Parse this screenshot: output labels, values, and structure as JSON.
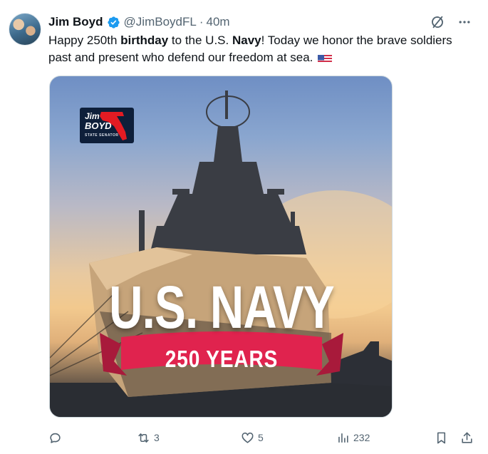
{
  "user": {
    "name": "Jim Boyd",
    "handle": "@JimBoydFL",
    "separator": "·",
    "time": "40m"
  },
  "tweet": {
    "text_part1": "Happy 250th ",
    "text_bold1": "birthday",
    "text_part2": " to the U.S. ",
    "text_bold2": "Navy",
    "text_part3": "! Today we honor the brave soldiers past and present who defend our freedom at sea. "
  },
  "media": {
    "logo_line1": "Jim",
    "logo_line2": "BOYD",
    "logo_line3": "STATE SENATOR",
    "headline": "U.S. NAVY",
    "banner": "250 YEARS"
  },
  "actions": {
    "reply_icon": "reply-icon",
    "repost_count": "3",
    "like_count": "5",
    "views_count": "232",
    "bookmark_icon": "bookmark-icon",
    "share_icon": "share-icon"
  },
  "colors": {
    "verified_blue": "#1d9bf0",
    "banner_red": "#e0234e",
    "text_secondary": "#536471"
  }
}
